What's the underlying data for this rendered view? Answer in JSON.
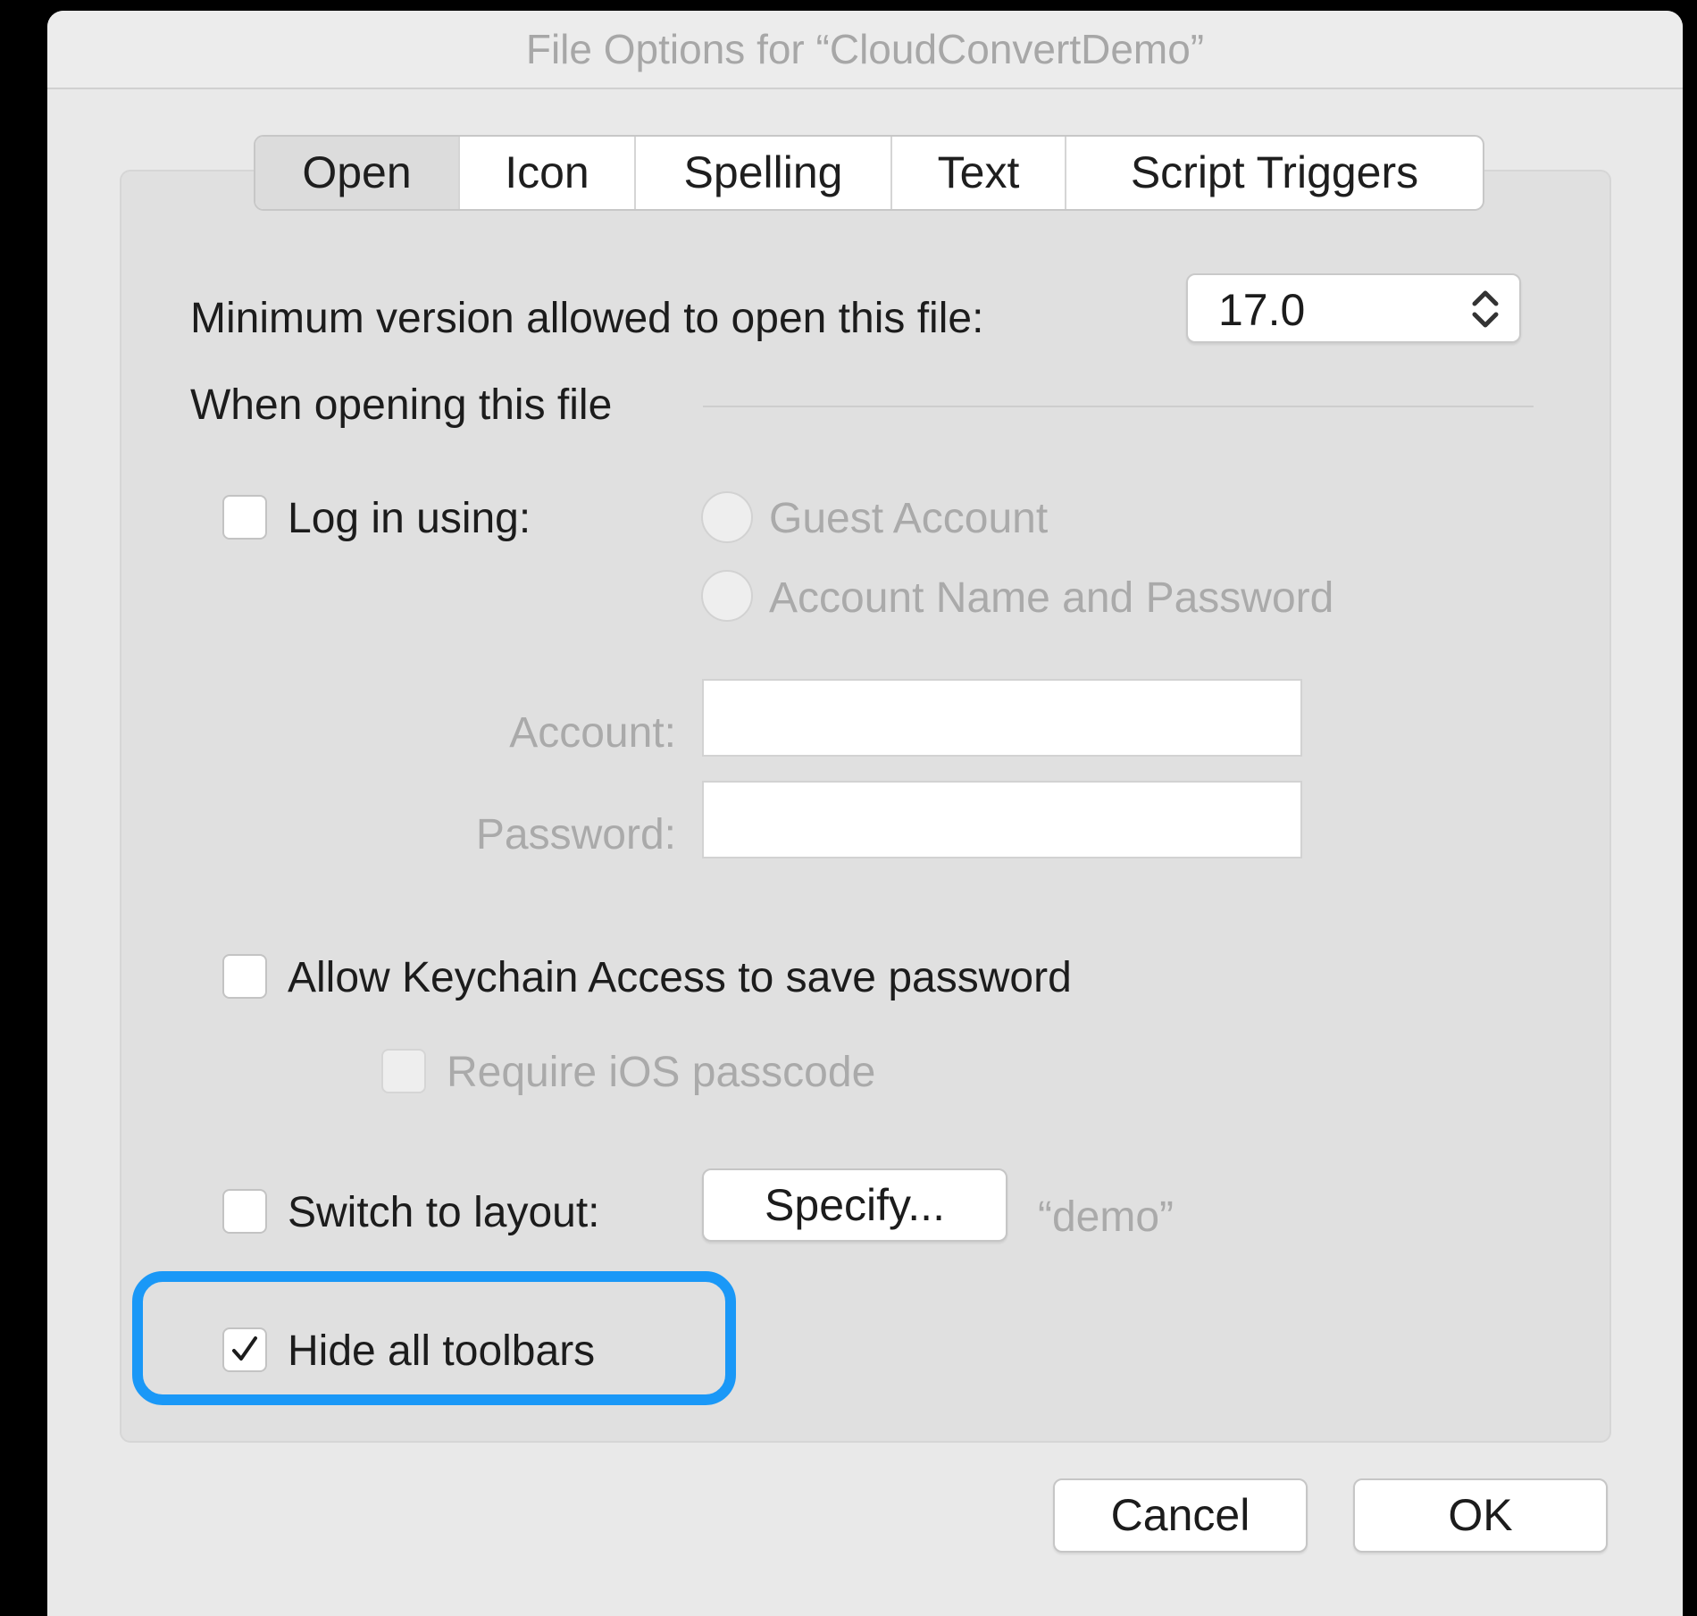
{
  "window": {
    "title": "File Options for “CloudConvertDemo”"
  },
  "tabs": [
    {
      "label": "Open",
      "active": true
    },
    {
      "label": "Icon",
      "active": false
    },
    {
      "label": "Spelling",
      "active": false
    },
    {
      "label": "Text",
      "active": false
    },
    {
      "label": "Script Triggers",
      "active": false
    }
  ],
  "open_tab": {
    "min_version_label": "Minimum version allowed to open this file:",
    "min_version_value": "17.0",
    "section_heading": "When opening this file",
    "login": {
      "label": "Log in using:",
      "checked": false,
      "options": [
        "Guest Account",
        "Account Name and Password"
      ],
      "account_label": "Account:",
      "account_value": "",
      "password_label": "Password:",
      "password_value": ""
    },
    "keychain": {
      "label": "Allow Keychain Access to save password",
      "checked": false,
      "require_ios_label": "Require iOS passcode",
      "require_ios_checked": false
    },
    "switch_layout": {
      "label": "Switch to layout:",
      "checked": false,
      "button_label": "Specify...",
      "layout_name": "“demo”"
    },
    "hide_toolbars": {
      "label": "Hide all toolbars",
      "checked": true
    }
  },
  "buttons": {
    "cancel": "Cancel",
    "ok": "OK"
  },
  "colors": {
    "highlight": "#1a98f7",
    "background": "#000000",
    "window": "#e9e9e9"
  }
}
